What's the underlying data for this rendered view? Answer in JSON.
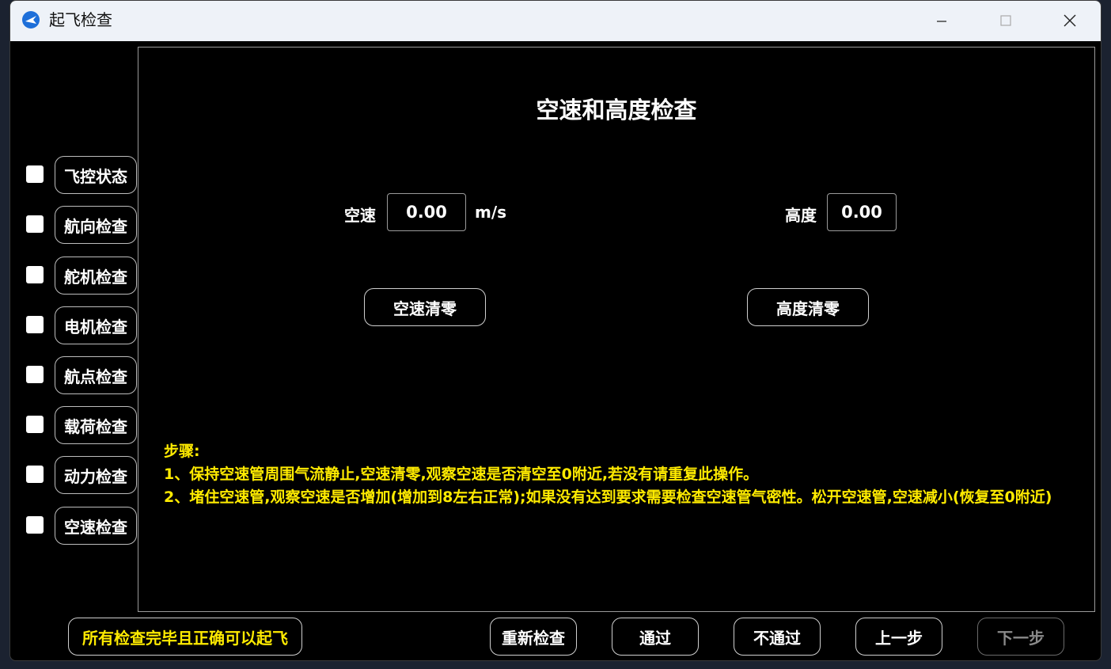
{
  "window": {
    "title": "起飞检查",
    "controls": [
      "minimize",
      "maximize",
      "close"
    ]
  },
  "sidebar": {
    "items": [
      {
        "label": "飞控状态",
        "checked": false
      },
      {
        "label": "航向检查",
        "checked": false
      },
      {
        "label": "舵机检查",
        "checked": false
      },
      {
        "label": "电机检查",
        "checked": false
      },
      {
        "label": "航点检查",
        "checked": false
      },
      {
        "label": "载荷检查",
        "checked": false
      },
      {
        "label": "动力检查",
        "checked": false
      },
      {
        "label": "空速检查",
        "checked": false
      }
    ]
  },
  "panel": {
    "title": "空速和高度检查",
    "airspeed": {
      "label": "空速",
      "value": "0.00",
      "unit": "m/s"
    },
    "altitude": {
      "label": "高度",
      "value": "0.00"
    },
    "airspeed_zero_button": "空速清零",
    "altitude_zero_button": "高度清零",
    "steps": {
      "heading": "步骤:",
      "lines": [
        "1、保持空速管周围气流静止,空速清零,观察空速是否清空至0附近,若没有请重复此操作。",
        "2、堵住空速管,观察空速是否增加(增加到8左右正常);如果没有达到要求需要检查空速管气密性。松开空速管,空速减小(恢复至0附近)"
      ]
    }
  },
  "footer": {
    "status_button": "所有检查完毕且正确可以起飞",
    "recheck_button": "重新检查",
    "pass_button": "通过",
    "fail_button": "不通过",
    "prev_button": "上一步",
    "next_button": "下一步"
  },
  "colors": {
    "background": "#000000",
    "steps_text": "#ffeb00",
    "titlebar": "#eef2f8"
  }
}
